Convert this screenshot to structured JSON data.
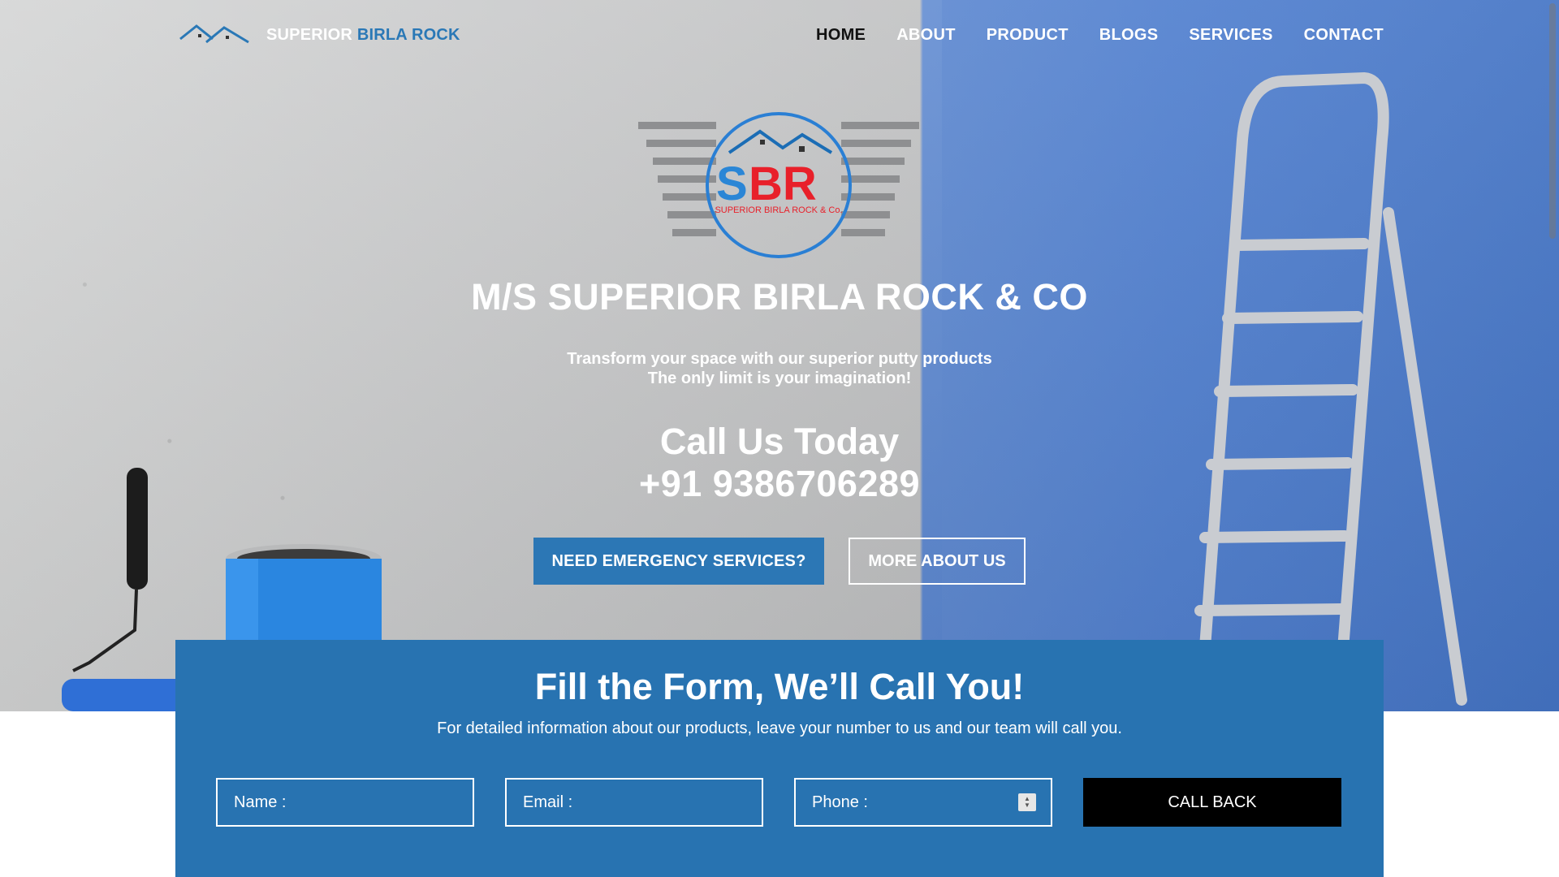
{
  "nav": {
    "brand_part1": "SUPERIOR ",
    "brand_part2": "BIRLA ROCK",
    "brand_icon": "house-roof-icon",
    "items": [
      "HOME",
      "ABOUT",
      "PRODUCT",
      "BLOGS",
      "SERVICES",
      "CONTACT"
    ],
    "active_item": "HOME"
  },
  "logo": {
    "letters_blue": "S",
    "letters_red": "BR",
    "ring_text": "SUPERIOR BIRLA ROCK & Co."
  },
  "hero": {
    "company_name": "M/S SUPERIOR BIRLA ROCK & CO",
    "tagline_line1": "Transform your space with our superior putty products",
    "tagline_line2": "The only limit is your imagination!",
    "call_title": "Call Us Today",
    "phone": "+91 9386706289",
    "primary_button": "NEED EMERGENCY SERVICES?",
    "secondary_button": "MORE ABOUT US"
  },
  "form": {
    "title": "Fill the Form, We’ll Call You!",
    "subtitle": "For detailed information about our products, leave your number to us and our team will call you.",
    "name_placeholder": "Name :",
    "email_placeholder": "Email :",
    "phone_placeholder": "Phone :",
    "submit_label": "CALL BACK"
  },
  "colors": {
    "accent_blue": "#2c77b5",
    "form_blue": "#2873b1",
    "logo_red": "#e8202a",
    "call_button": "#000000"
  }
}
